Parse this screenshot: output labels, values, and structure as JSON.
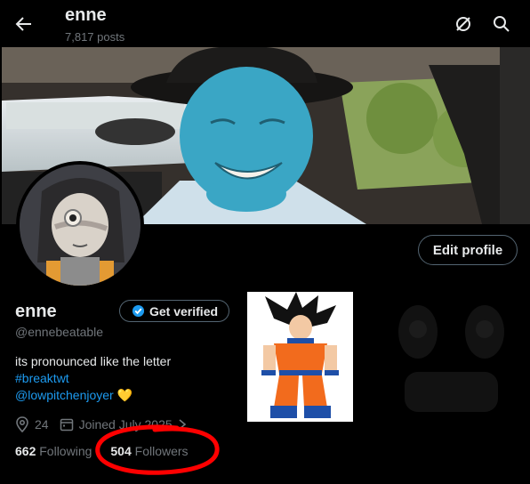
{
  "header": {
    "display_name": "enne",
    "post_count": "7,817 posts"
  },
  "profile": {
    "display_name": "enne",
    "handle": "@ennebeatable",
    "edit_profile_label": "Edit profile",
    "get_verified_label": "Get verified",
    "bio": {
      "line1": "its pronounced like the letter",
      "hashtag": "#breaktwt",
      "mention": "@lowpitchenjoyer",
      "emoji": "💛"
    },
    "location": "24",
    "joined": "Joined July 2025",
    "following_count": "662",
    "following_label": "Following",
    "followers_count": "504",
    "followers_label": "Followers"
  },
  "colors": {
    "accent": "#1d9bf0",
    "muted": "#71767b",
    "annotation_red": "#ff0000"
  },
  "icons": [
    "back-arrow-icon",
    "grok-icon",
    "search-icon",
    "verified-badge-icon",
    "location-icon",
    "calendar-icon",
    "chevron-right-icon"
  ]
}
